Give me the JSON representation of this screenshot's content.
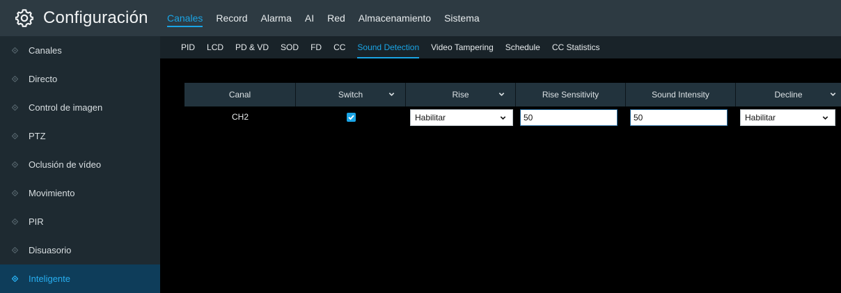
{
  "app": {
    "title": "Configuración",
    "icon": "gear-icon"
  },
  "top_nav": [
    {
      "label": "Canales",
      "active": true
    },
    {
      "label": "Record",
      "active": false
    },
    {
      "label": "Alarma",
      "active": false
    },
    {
      "label": "AI",
      "active": false
    },
    {
      "label": "Red",
      "active": false
    },
    {
      "label": "Almacenamiento",
      "active": false
    },
    {
      "label": "Sistema",
      "active": false
    }
  ],
  "sidebar": {
    "items": [
      {
        "label": "Canales",
        "active": false
      },
      {
        "label": "Directo",
        "active": false
      },
      {
        "label": "Control de imagen",
        "active": false
      },
      {
        "label": "PTZ",
        "active": false
      },
      {
        "label": "Oclusión de vídeo",
        "active": false
      },
      {
        "label": "Movimiento",
        "active": false
      },
      {
        "label": "PIR",
        "active": false
      },
      {
        "label": "Disuasorio",
        "active": false
      },
      {
        "label": "Inteligente",
        "active": true
      }
    ]
  },
  "subtabs": [
    {
      "label": "PID",
      "active": false
    },
    {
      "label": "LCD",
      "active": false
    },
    {
      "label": "PD & VD",
      "active": false
    },
    {
      "label": "SOD",
      "active": false
    },
    {
      "label": "FD",
      "active": false
    },
    {
      "label": "CC",
      "active": false
    },
    {
      "label": "Sound Detection",
      "active": true
    },
    {
      "label": "Video Tampering",
      "active": false
    },
    {
      "label": "Schedule",
      "active": false
    },
    {
      "label": "CC Statistics",
      "active": false
    }
  ],
  "table": {
    "headers": {
      "canal": "Canal",
      "switch": "Switch",
      "rise": "Rise",
      "rise_sensitivity": "Rise Sensitivity",
      "sound_intensity": "Sound Intensity",
      "decline": "Decline"
    },
    "rows": [
      {
        "canal": "CH2",
        "switch": true,
        "rise": "Habilitar",
        "rise_sensitivity": "50",
        "sound_intensity": "50",
        "decline": "Habilitar"
      }
    ]
  },
  "colors": {
    "accent": "#1aa5e6",
    "topbar": "#2d3a42",
    "sidebar": "#1e2a31",
    "sidebar_active": "#0e3d5a",
    "content_bg": "#000000",
    "table_header": "#22333d"
  }
}
